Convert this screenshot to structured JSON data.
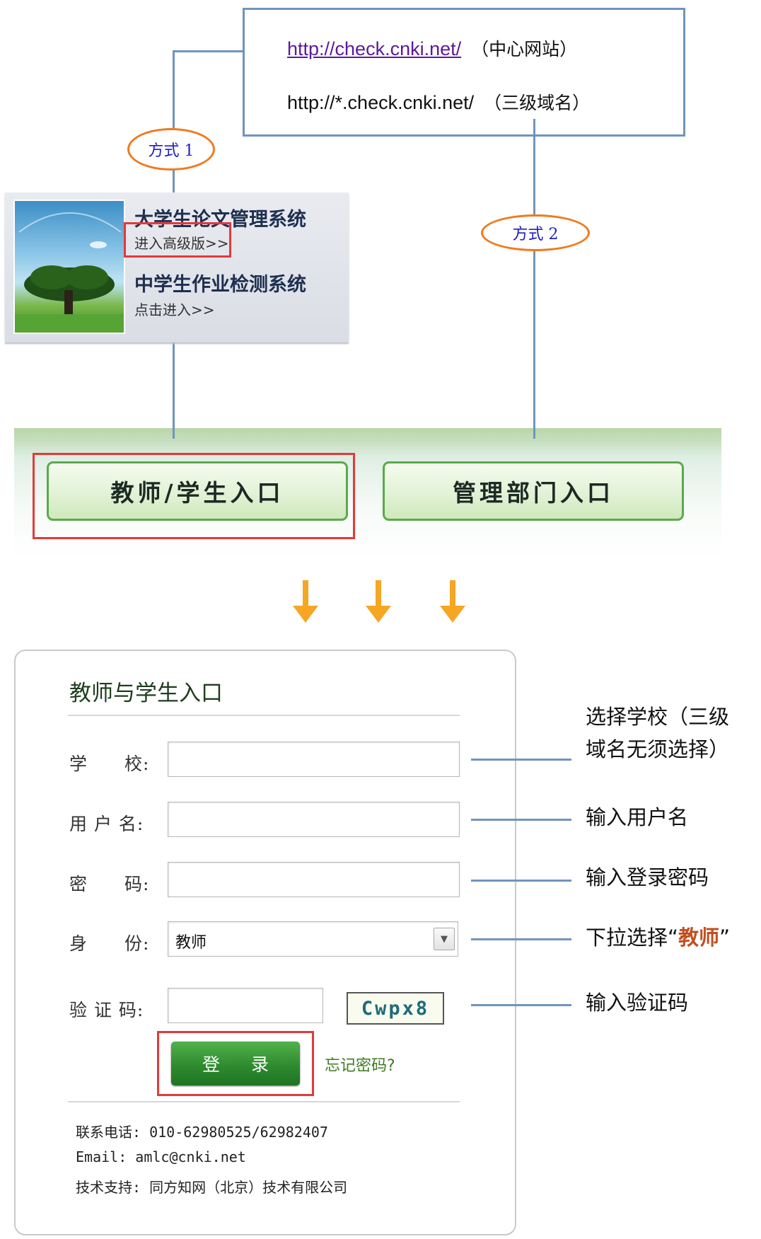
{
  "url_box": {
    "center_url": "http://check.cnki.net/",
    "center_note": "（中心网站）",
    "subdomain_url": "http://*.check.cnki.net/",
    "subdomain_note": "（三级域名）"
  },
  "methods": {
    "method1": "方式 1",
    "method2": "方式 2"
  },
  "portal": {
    "college_title": "大学生论文管理系统",
    "college_link": "进入高级版>>",
    "middle_title": "中学生作业检测系统",
    "middle_link": "点击进入>>"
  },
  "entry_buttons": {
    "teacher_student": "教师/学生入口",
    "admin": "管理部门入口"
  },
  "login": {
    "title": "教师与学生入口",
    "labels": {
      "school": "学　　校:",
      "username": "用 户 名:",
      "password": "密　　码:",
      "identity": "身　　份:",
      "captcha": "验 证 码:"
    },
    "identity_value": "教师",
    "captcha_text": "Cwpx8",
    "submit": "登 录",
    "forgot": "忘记密码?",
    "footer": {
      "phone": "联系电话: 010-62980525/62982407",
      "email": "Email: amlc@cnki.net",
      "support": "技术支持: 同方知网（北京）技术有限公司"
    }
  },
  "annotations": {
    "school_line1": "选择学校（三级",
    "school_line2": "域名无须选择）",
    "username": "输入用户名",
    "password": "输入登录密码",
    "identity_prefix": "下拉选择“",
    "identity_highlight": "教师",
    "identity_suffix": "”",
    "captcha": "输入验证码"
  },
  "colors": {
    "connector": "#6f95bd",
    "highlight_red": "#e23a3a",
    "badge_orange": "#f07a1e",
    "arrow_orange": "#f5a623",
    "accent_green": "#2e8b2f"
  }
}
